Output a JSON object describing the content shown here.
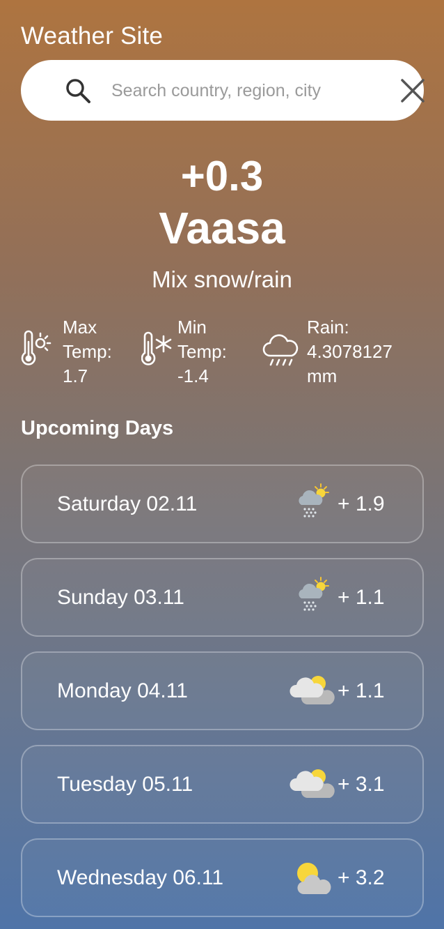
{
  "app": {
    "title": "Weather Site"
  },
  "search": {
    "placeholder": "Search country, region, city",
    "value": ""
  },
  "current": {
    "temperature": "+0.3",
    "city": "Vaasa",
    "condition": "Mix snow/rain",
    "max_temp": {
      "line1": "Max",
      "line2": "Temp:",
      "value": "1.7"
    },
    "min_temp": {
      "line1": "Min",
      "line2": "Temp:",
      "value": "-1.4"
    },
    "rain": {
      "line1": "Rain:",
      "value": "4.3078127",
      "unit": "mm"
    }
  },
  "upcoming": {
    "title": "Upcoming Days",
    "days": [
      {
        "label": "Saturday 02.11",
        "temp": "+ 1.9",
        "icon": "snow-sun-icon"
      },
      {
        "label": "Sunday 03.11",
        "temp": "+ 1.1",
        "icon": "snow-sun-icon"
      },
      {
        "label": "Monday 04.11",
        "temp": "+ 1.1",
        "icon": "cloudy-icon"
      },
      {
        "label": "Tuesday 05.11",
        "temp": "+ 3.1",
        "icon": "cloudy-icon"
      },
      {
        "label": "Wednesday 06.11",
        "temp": "+ 3.2",
        "icon": "partly-sunny-icon"
      }
    ]
  },
  "colors": {
    "gradient_top": "#ae7440",
    "gradient_bottom": "#4f74a8",
    "sun": "#f7d63b",
    "cloud_light": "#e7e7e7",
    "cloud_dark": "#bdbdbd",
    "snow_cloud": "#aab5bf"
  }
}
